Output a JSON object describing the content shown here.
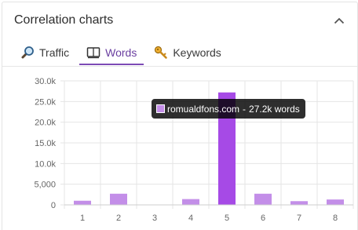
{
  "panel": {
    "title": "Correlation charts"
  },
  "tabs": [
    {
      "label": "Traffic",
      "icon": "magnifier-icon",
      "active": false
    },
    {
      "label": "Words",
      "icon": "book-icon",
      "active": true
    },
    {
      "label": "Keywords",
      "icon": "key-icon",
      "active": false
    }
  ],
  "tooltip": {
    "site": "romualdfons.com",
    "separator": "-",
    "value": "27.2k words"
  },
  "colors": {
    "accent": "#7d4bb5",
    "bar": "#c38ee8",
    "bar_highlight": "#a64ae6",
    "grid": "#e5e5e5"
  },
  "chart_data": {
    "type": "bar",
    "categories": [
      "1",
      "2",
      "3",
      "4",
      "5",
      "6",
      "7",
      "8"
    ],
    "values": [
      1000,
      2700,
      0,
      1400,
      27200,
      2700,
      900,
      1300
    ],
    "highlight_index": 4,
    "ylim": [
      0,
      30000
    ],
    "yticks": [
      0,
      5000,
      10000,
      15000,
      20000,
      25000,
      30000
    ],
    "ytick_labels": [
      "0",
      "5,000",
      "10.0k",
      "15.0k",
      "20.0k",
      "25.0k",
      "30.0k"
    ],
    "grid": true,
    "title": "",
    "xlabel": "",
    "ylabel": ""
  }
}
